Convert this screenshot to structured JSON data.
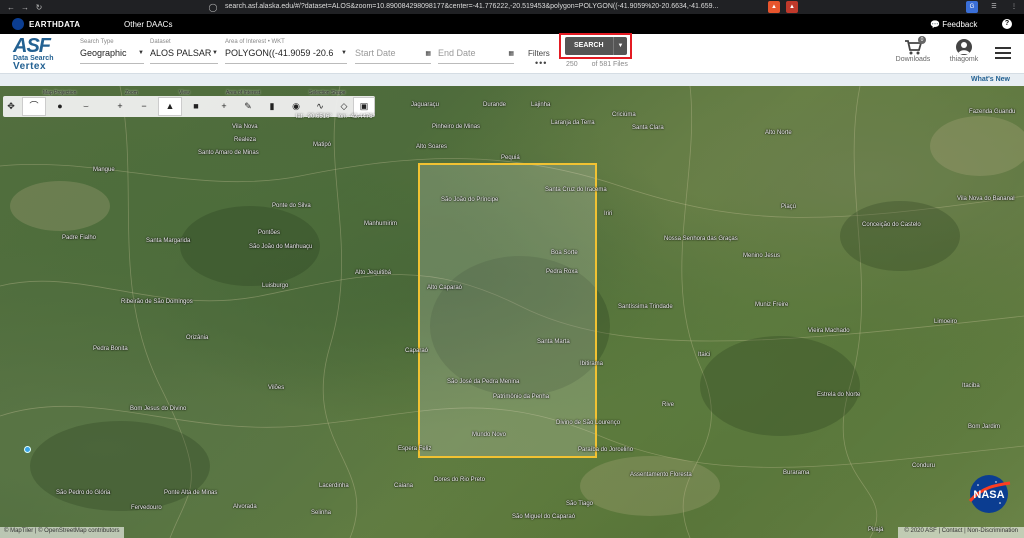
{
  "browser": {
    "url": "search.asf.alaska.edu/#/?dataset=ALOS&zoom=10.890084298098177&center=-41.776222,-20.519453&polygon=POLYGON((-41.9059%20-20.6634,-41.659..."
  },
  "topbar": {
    "logo_text": "EARTHDATA",
    "other_daacs": "Other DAACs",
    "feedback": "Feedback",
    "help": "?"
  },
  "header": {
    "logo": {
      "line1": "ASF",
      "line2": "Data Search",
      "line3": "Vertex"
    },
    "search_type": {
      "label": "Search Type",
      "value": "Geographic"
    },
    "dataset": {
      "label": "Dataset",
      "value": "ALOS PALSAR"
    },
    "aoi": {
      "label": "Area of Interest • WKT",
      "value": "POLYGON((-41.9059 -20.6"
    },
    "start_date": {
      "placeholder": "Start Date"
    },
    "end_date": {
      "placeholder": "End Date"
    },
    "filters": "Filters",
    "filters_dots": "•••",
    "search_button": "SEARCH",
    "files": {
      "count": "250",
      "of": "of 581 Files"
    },
    "downloads": {
      "label": "Downloads",
      "badge": "0"
    },
    "user": {
      "label": "thiagomk"
    },
    "whats_new": "What's New"
  },
  "toolbar": {
    "groups": {
      "map_projection": "Map Projection",
      "zoom": "Zoom",
      "view": "View",
      "area_of_interest": "Area of Interest",
      "selection_shape": "Selection Shape"
    },
    "coords": {
      "lat": "lat: -20.6516°",
      "lon": "lon: -42.4476°"
    }
  },
  "map_places": [
    "Jaguaraçu",
    "Durande",
    "Lajinha",
    "Criciúma",
    "Fazenda Guandu",
    "Vila Nova",
    "Pinheiro de Minas",
    "Laranja da Terra",
    "Santa Clara",
    "Alto Norte",
    "Realeza",
    "Matipó",
    "Alto Soares",
    "Pequiá",
    "Santo Amaro de Minas",
    "Mangue",
    "Santa Cruz do Iracema",
    "São João do Príncipe",
    "Ponte do Silva",
    "Manhumirim",
    "Iriri",
    "Piaçú",
    "Vila Nova do Bananal",
    "Conceição do Castelo",
    "Padre Fialho",
    "Santa Margarida",
    "Pontões",
    "São João do Manhuaçu",
    "Boa Sorte",
    "Nossa Senhora das Graças",
    "Menino Jesus",
    "Pedra Roxa",
    "Alto Jequitibá",
    "Luisburgo",
    "Alto Caparaó",
    "Ribeirão de São Domingos",
    "Santíssima Trindade",
    "Muniz Freire",
    "Limoeiro",
    "Vieira Machado",
    "Pedra Bonita",
    "Orizânia",
    "Santa Marta",
    "Caparaó",
    "Ibitirama",
    "Itaici",
    "Vilões",
    "São José da Pedra Menina",
    "Patrimônio da Penha",
    "Estrela do Norte",
    "Bom Jesus do Divino",
    "Rive",
    "Mundo Novo",
    "Divino de São Lourenço",
    "Espera Feliz",
    "Ponte Alta de Minas",
    "Dores do Rio Preto",
    "Paraíba do Jorcelino",
    "Assentamento Floresta",
    "Burarama",
    "Conduru",
    "São Pedro do Glória",
    "Lacerdinha",
    "Caiana",
    "Bom Jardim",
    "Fervedouro",
    "Alvorada",
    "Selinha",
    "São Tiago",
    "São Miguel do Caparaó",
    "Itaciba",
    "Pirajá"
  ],
  "footer": {
    "attribution": "© MapTiler | © OpenStreetMap contributors",
    "right": "© 2020 ASF | Contact | Non-Discrimination"
  }
}
